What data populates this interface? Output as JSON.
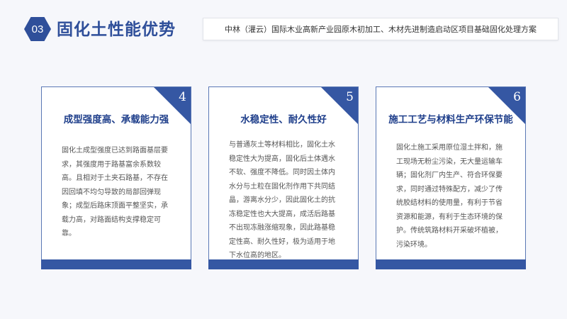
{
  "header": {
    "section_number": "03",
    "title": "固化土性能优势",
    "subtitle": "中林（灌云）国际木业高新产业园原木初加工、木材先进制造启动区项目基础固化处理方案"
  },
  "cards": [
    {
      "number": "4",
      "title": "成型强度高、承载能力强",
      "text": "固化土成型强度已达到路面基层要求，其强度用于路基富余系数较高。且相对于土夹石路基，不存在因回填不均匀导致的局部回弹现象；成型后路床顶面平整坚实，承载力高，对路面结构支撑稳定可靠。"
    },
    {
      "number": "5",
      "title": "水稳定性、耐久性好",
      "text": "与普通灰土等材料相比，固化土水稳定性大为提高，固化后土体遇水不软、强度不降低。同时因土体内水分与土粒在固化剂作用下共同结晶，游离水分少，因此固化土的抗冻稳定性也大大提高，成活后路基不出现冻融涨缩现象，因此路基稳定性高、耐久性好，极为适用于地下水位高的地区。"
    },
    {
      "number": "6",
      "title": "施工工艺与材料生产环保节能",
      "text": "固化土施工采用原位湿土拌和，施工现场无粉尘污染，无大量运输车辆；固化剂厂内生产、符合环保要求，同时通过特殊配方，减少了传统胶结材料的使用量，有利于节省资源和能源，有利于生态环境的保护。传统筑路材料开采破坏植被，污染环境。"
    }
  ]
}
